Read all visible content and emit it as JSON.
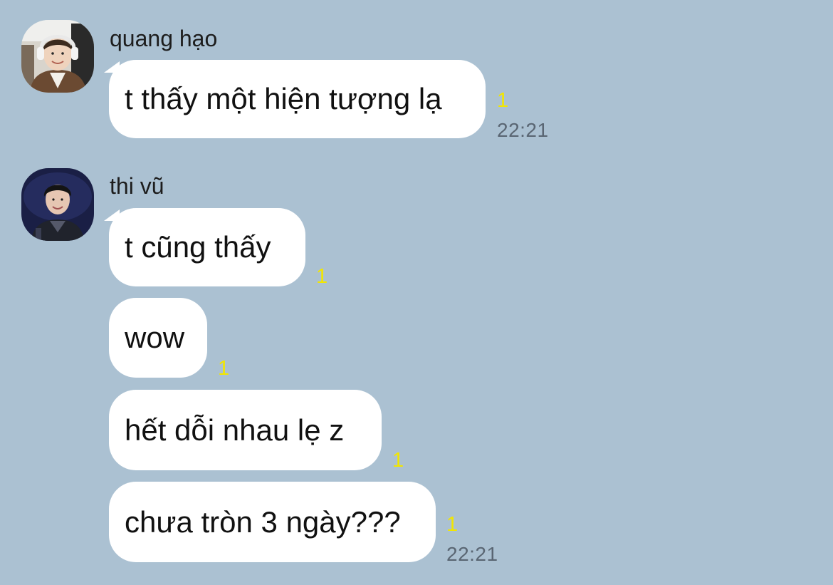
{
  "colors": {
    "background": "#abc1d2",
    "bubble": "#ffffff",
    "unread": "#f2e600",
    "time": "#5a6673"
  },
  "groups": [
    {
      "sender": "quang hạo",
      "avatar_icon": "profile-photo-quang-hao",
      "messages": [
        {
          "text": "t thấy một hiện tượng lạ",
          "unread": "1",
          "time": "22:21"
        }
      ]
    },
    {
      "sender": "thi vũ",
      "avatar_icon": "profile-photo-thi-vu",
      "messages": [
        {
          "text": "t cũng thấy",
          "unread": "1"
        },
        {
          "text": "wow",
          "unread": "1"
        },
        {
          "text": "hết dỗi nhau lẹ z",
          "unread": "1"
        },
        {
          "text": "chưa tròn 3 ngày???",
          "unread": "1",
          "time": "22:21"
        }
      ]
    }
  ]
}
